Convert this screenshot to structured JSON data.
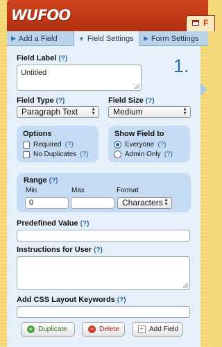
{
  "app": {
    "logo_text": "WUFOO",
    "header_tab_letter": "F"
  },
  "tabs": [
    {
      "label": "Add a Field",
      "active": false
    },
    {
      "label": "Field Settings",
      "active": true
    },
    {
      "label": "Form Settings",
      "active": false
    }
  ],
  "step_number": "1.",
  "help_marker": "(?)",
  "field_label": {
    "label": "Field Label",
    "value": "Untitled"
  },
  "field_type": {
    "label": "Field Type",
    "selected": "Paragraph Text"
  },
  "field_size": {
    "label": "Field Size",
    "selected": "Medium"
  },
  "options": {
    "title": "Options",
    "required": {
      "label": "Required",
      "checked": false
    },
    "no_duplicates": {
      "label": "No Duplicates",
      "checked": false
    }
  },
  "show_field_to": {
    "title": "Show Field to",
    "everyone": {
      "label": "Everyone",
      "selected": true
    },
    "admin_only": {
      "label": "Admin Only",
      "selected": false
    }
  },
  "range": {
    "title": "Range",
    "min_label": "Min",
    "max_label": "Max",
    "format_label": "Format",
    "min_value": "0",
    "max_value": "",
    "format_selected": "Characters"
  },
  "predefined_value": {
    "label": "Predefined Value",
    "value": ""
  },
  "instructions": {
    "label": "Instructions for User",
    "value": ""
  },
  "css_keywords": {
    "label": "Add CSS Layout Keywords",
    "value": ""
  },
  "buttons": {
    "duplicate": "Duplicate",
    "delete": "Delete",
    "add_field": "Add Field"
  },
  "colors": {
    "brand_red": "#c13a16",
    "panel_bg": "#e6f0fa",
    "group_bg": "#c5dcf4",
    "link_blue": "#2a6aa9",
    "frame_yellow": "#f5d97a"
  }
}
